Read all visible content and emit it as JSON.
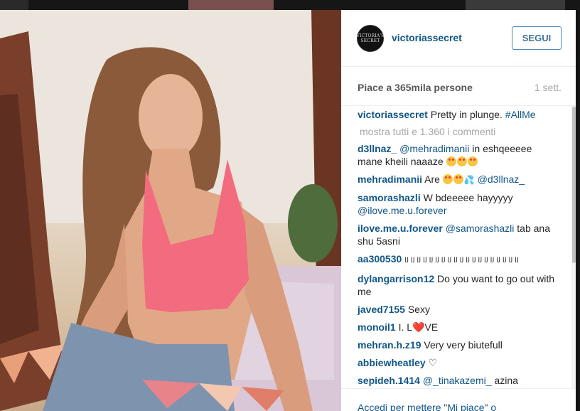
{
  "post": {
    "username": "victoriassecret",
    "avatar_text": "VICTORIA'S SECRET",
    "follow_label": "SEGUI",
    "likes": "Piace a 365mila persone",
    "time": "1 sett."
  },
  "caption": {
    "user": "victoriassecret",
    "text": "Pretty in plunge.",
    "hashtag": "#AllMe"
  },
  "show_all": "mostra tutti e 1.360 i commenti",
  "comments": [
    {
      "user": "d3llnaz_",
      "mention": "@mehradimanii",
      "text": " in eshqeeeee mane kheili naaaze ",
      "emoji": 3
    },
    {
      "user": "mehradimanii",
      "text": "Are ",
      "emoji": 2,
      "drops": true,
      "mention_after": "@d3llnaz_"
    },
    {
      "user": "samorashazli",
      "text": "W bdeeeee hayyyyy ",
      "mention_after": "@ilove.me.u.forever"
    },
    {
      "user": "ilove.me.u.forever",
      "mention": "@samorashazli",
      "text": " tab ana shu 5asni"
    },
    {
      "user": "aa300530",
      "text": "ﻟا ﻟا ﻟا ﻟا ﻟا ﻟا ﻟا ﻟا ﻟا ﻟا ﻟا ﻟا ﻟا ﻟا ﻟا ﻟا ﻟا ﻟا ﻟا"
    },
    {
      "user": "dylangarrison12",
      "text": "Do you want to go out with me"
    },
    {
      "user": "javed7155",
      "text": "Sexy"
    },
    {
      "user": "monoil1",
      "text": "I. L",
      "heart": "❤️",
      "text_after": "VE"
    },
    {
      "user": "mehran.h.z19",
      "text": "Very very biutefull"
    },
    {
      "user": "abbiewheatley",
      "text": "♡"
    },
    {
      "user": "sepideh.1414",
      "mention": "@_tinakazemi_",
      "text": " azina"
    }
  ],
  "footer": {
    "login_text": "Accedi per mettere \"Mi piace\" o"
  },
  "colors": {
    "link": "#125688",
    "follow_border": "#4c87b7",
    "muted": "#a5a7aa",
    "top_bra": "#f36b7f"
  },
  "icons": [
    "scrollbar-thumb",
    "heart-emoji",
    "heart-eyes-emoji",
    "droplets-emoji"
  ]
}
